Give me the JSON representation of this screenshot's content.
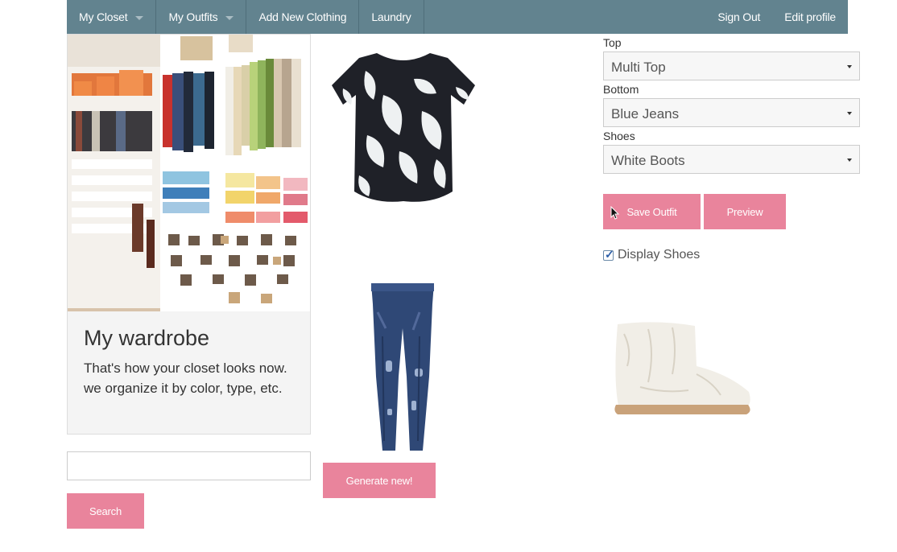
{
  "nav": {
    "left_items": [
      {
        "label": "My Closet",
        "dropdown": true
      },
      {
        "label": "My Outfits",
        "dropdown": true
      },
      {
        "label": "Add New Clothing",
        "dropdown": false
      },
      {
        "label": "Laundry",
        "dropdown": false
      }
    ],
    "right_items": [
      {
        "label": "Sign Out"
      },
      {
        "label": "Edit profile"
      }
    ],
    "colors": {
      "background": "#62838f",
      "text": "#ffffff"
    }
  },
  "card": {
    "title": "My wardrobe",
    "text": "That's how your closet looks now. we organize it by color, type, etc."
  },
  "search": {
    "value": "",
    "placeholder": "",
    "button_label": "Search"
  },
  "generate_button_label": "Generate new!",
  "form": {
    "top": {
      "label": "Top",
      "selected": "Multi Top"
    },
    "bottom": {
      "label": "Bottom",
      "selected": "Blue Jeans"
    },
    "shoes": {
      "label": "Shoes",
      "selected": "White Boots"
    },
    "save_label": "Save Outfit",
    "preview_label": "Preview",
    "display_shoes": {
      "label": "Display Shoes",
      "checked": true
    }
  },
  "accent_color": "#e9849c"
}
